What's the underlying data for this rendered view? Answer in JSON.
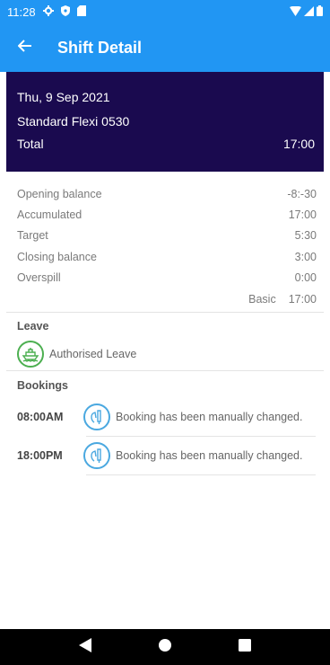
{
  "status_bar": {
    "time": "11:28"
  },
  "app_bar": {
    "title": "Shift Detail"
  },
  "shift": {
    "date": "Thu, 9 Sep 2021",
    "name": "Standard Flexi 0530",
    "total_label": "Total",
    "total_value": "17:00"
  },
  "balances": [
    {
      "label": "Opening balance",
      "value": "-8:-30"
    },
    {
      "label": "Accumulated",
      "value": "17:00"
    },
    {
      "label": "Target",
      "value": "5:30"
    },
    {
      "label": "Closing balance",
      "value": "3:00"
    },
    {
      "label": "Overspill",
      "value": "0:00"
    }
  ],
  "basic": {
    "label": "Basic",
    "value": "17:00"
  },
  "leave": {
    "title": "Leave",
    "item": "Authorised Leave",
    "icon": "ship-icon",
    "color": "#4caf50"
  },
  "bookings": {
    "title": "Bookings",
    "items": [
      {
        "time": "08:00AM",
        "text": "Booking has been manually changed.",
        "icon": "hand-edit-icon"
      },
      {
        "time": "18:00PM",
        "text": "Booking has been manually changed.",
        "icon": "hand-edit-icon"
      }
    ]
  },
  "colors": {
    "primary": "#2196f3",
    "header_bg": "#1a0a4f",
    "accent_blue": "#4aa8e0"
  }
}
